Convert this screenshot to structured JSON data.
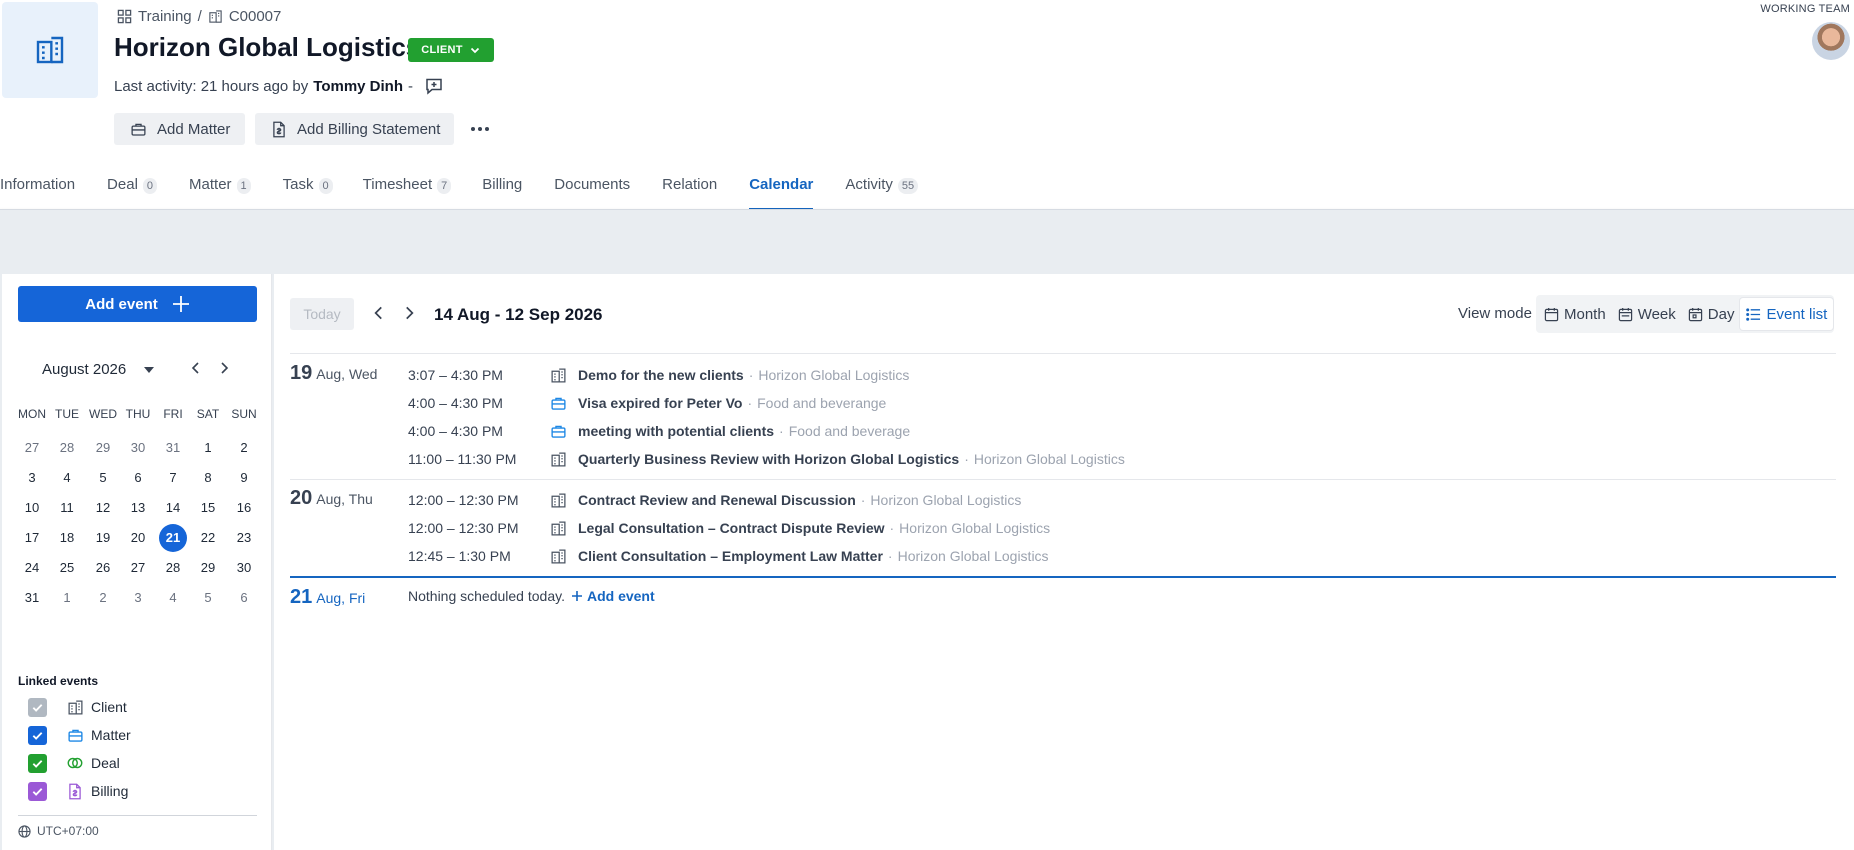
{
  "breadcrumb": {
    "root": "Training",
    "separator": "/",
    "code": "C00007"
  },
  "title": "Horizon Global Logistics",
  "status_badge": "CLIENT",
  "last_activity": {
    "prefix": "Last activity: 21 hours ago by",
    "user": "Tommy Dinh",
    "suffix": "-"
  },
  "actions": {
    "add_matter": "Add Matter",
    "add_billing": "Add Billing Statement"
  },
  "working_team": "WORKING TEAM",
  "tabs": [
    {
      "label": "Information",
      "count": ""
    },
    {
      "label": "Deal",
      "count": "0"
    },
    {
      "label": "Matter",
      "count": "1"
    },
    {
      "label": "Task",
      "count": "0"
    },
    {
      "label": "Timesheet",
      "count": "7"
    },
    {
      "label": "Billing",
      "count": ""
    },
    {
      "label": "Documents",
      "count": ""
    },
    {
      "label": "Relation",
      "count": ""
    },
    {
      "label": "Calendar",
      "count": "",
      "active": true
    },
    {
      "label": "Activity",
      "count": "55"
    }
  ],
  "sidebar": {
    "add_event": "Add event",
    "month_label": "August 2026",
    "weekdays": [
      "MON",
      "TUE",
      "WED",
      "THU",
      "FRI",
      "SAT",
      "SUN"
    ],
    "weeks": [
      [
        "27",
        "28",
        "29",
        "30",
        "31",
        "1",
        "2"
      ],
      [
        "3",
        "4",
        "5",
        "6",
        "7",
        "8",
        "9"
      ],
      [
        "10",
        "11",
        "12",
        "13",
        "14",
        "15",
        "16"
      ],
      [
        "17",
        "18",
        "19",
        "20",
        "21",
        "22",
        "23"
      ],
      [
        "24",
        "25",
        "26",
        "27",
        "28",
        "29",
        "30"
      ],
      [
        "31",
        "1",
        "2",
        "3",
        "4",
        "5",
        "6"
      ]
    ],
    "today": "21",
    "linked_title": "Linked events",
    "linked": [
      {
        "label": "Client",
        "color": "#b0b8c1"
      },
      {
        "label": "Matter",
        "color": "#1565d8"
      },
      {
        "label": "Deal",
        "color": "#22a030"
      },
      {
        "label": "Billing",
        "color": "#9b59d6"
      }
    ],
    "timezone": "UTC+07:00"
  },
  "toolbar": {
    "today": "Today",
    "range": "14 Aug - 12 Sep 2026",
    "view_mode_label": "View mode",
    "modes": [
      "Month",
      "Week",
      "Day",
      "Event list"
    ],
    "active_mode": "Event list"
  },
  "days": [
    {
      "num": "19",
      "label": "Aug, Wed",
      "events": [
        {
          "time": "3:07 – 4:30 PM",
          "icon": "building-icon",
          "title": "Demo for the new clients",
          "sep": "·",
          "sub": "Horizon Global Logistics"
        },
        {
          "time": "4:00 – 4:30 PM",
          "icon": "briefcase-icon",
          "title": "Visa expired for Peter Vo",
          "sep": "·",
          "sub": "Food and beverange"
        },
        {
          "time": "4:00 – 4:30 PM",
          "icon": "briefcase-icon",
          "title": "meeting with potential clients",
          "sep": "·",
          "sub": "Food and beverage"
        },
        {
          "time": "11:00 – 11:30 PM",
          "icon": "building-icon",
          "title": "Quarterly Business Review with Horizon Global Logistics",
          "sep": "·",
          "sub": "Horizon Global Logistics"
        }
      ]
    },
    {
      "num": "20",
      "label": "Aug, Thu",
      "events": [
        {
          "time": "12:00 – 12:30 PM",
          "icon": "building-icon",
          "title": "Contract Review and Renewal Discussion",
          "sep": "·",
          "sub": "Horizon Global Logistics"
        },
        {
          "time": "12:00 – 12:30 PM",
          "icon": "building-icon",
          "title": "Legal Consultation – Contract Dispute Review",
          "sep": "·",
          "sub": "Horizon Global Logistics"
        },
        {
          "time": "12:45 – 1:30 PM",
          "icon": "building-icon",
          "title": "Client Consultation – Employment Law Matter",
          "sep": "·",
          "sub": "Horizon Global Logistics"
        }
      ]
    },
    {
      "num": "21",
      "label": "Aug, Fri",
      "empty_text": "Nothing scheduled today.",
      "add_label": "Add event"
    }
  ]
}
